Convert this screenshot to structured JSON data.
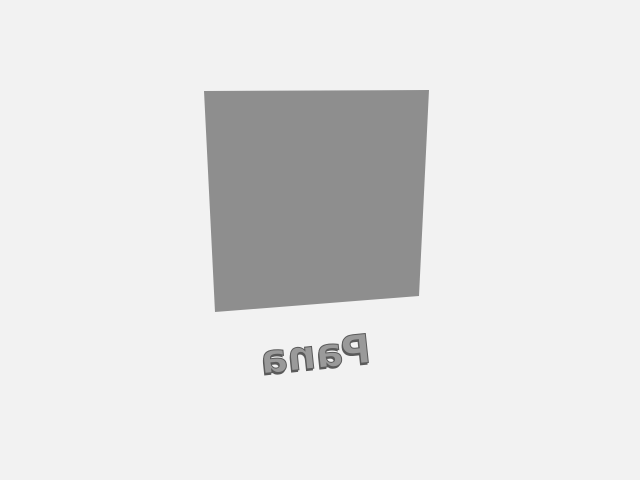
{
  "scene": {
    "background_color": "#f2f2f2",
    "panel": {
      "color": "#8e8e8e"
    },
    "label": {
      "text": "Pana",
      "color": "#9a9a9a",
      "outline_color": "#5a5a5a",
      "orientation": "mirrored"
    }
  }
}
